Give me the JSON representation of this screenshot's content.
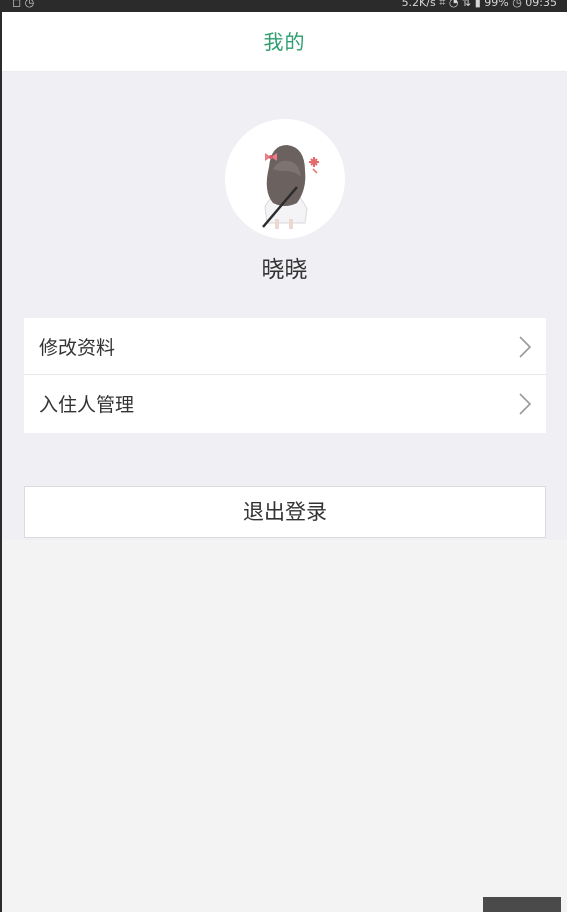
{
  "status_bar": {
    "left": "◻ ◷",
    "right": "5.2K/s ⌗ ◔ ⇅ ▮ 99% ◷ 09:35"
  },
  "header": {
    "title": "我的"
  },
  "profile": {
    "name": "晓晓"
  },
  "menu": {
    "items": [
      {
        "label": "修改资料"
      },
      {
        "label": "入住人管理"
      }
    ]
  },
  "logout": {
    "label": "退出登录"
  },
  "colors": {
    "title": "#2e9e70",
    "page_bg": "#efeff4",
    "card_bg": "#ffffff"
  },
  "icons": {
    "avatar": "girl-avatar-illustration",
    "menu_chevron": "chevron-right-icon"
  }
}
